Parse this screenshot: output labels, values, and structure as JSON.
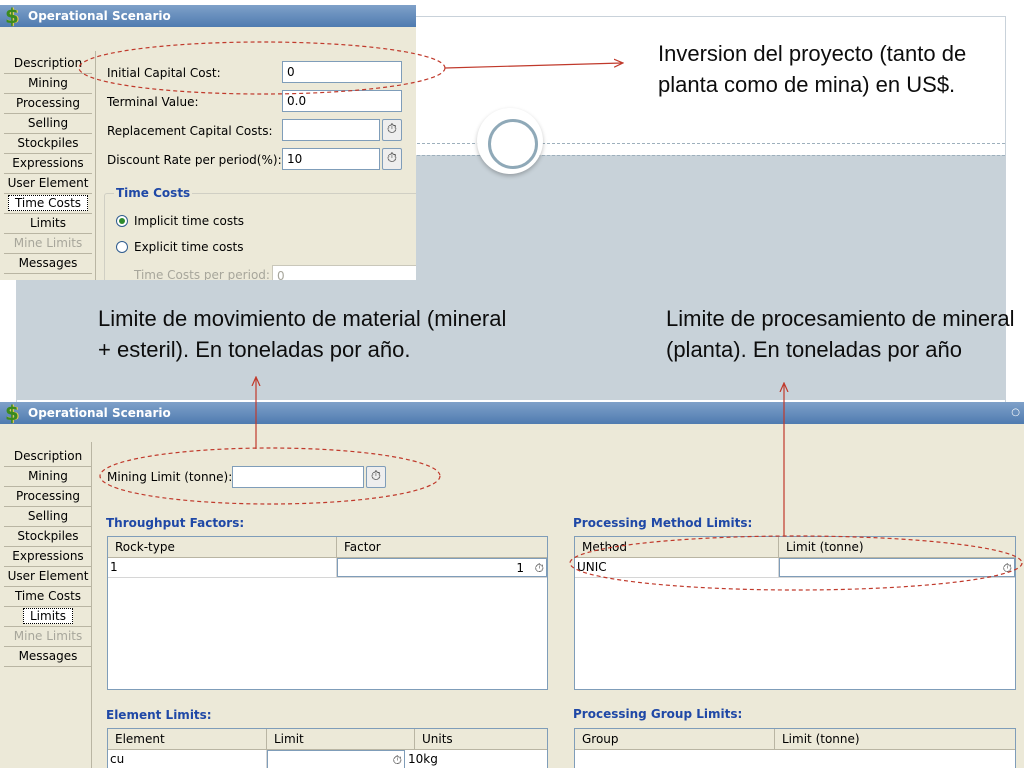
{
  "annotations": {
    "top_note": "Inversion del proyecto (tanto de planta como de mina) en US$.",
    "left_note": "Limite de movimiento de material (mineral + esteril). En toneladas por año.",
    "right_note": "Limite de procesamiento de mineral (planta). En toneladas por año"
  },
  "colors": {
    "callout_ellipse": "#c0392b",
    "title_bar": "#5a84b8",
    "panel_bg": "#ece9d8",
    "group_title": "#1f48a6",
    "slide_band": "#c8d2d9"
  },
  "icons": {
    "app": "dollar-sign-icon",
    "edit": "timer-icon",
    "pin": "pin-icon"
  },
  "nav_items": [
    "Description",
    "Mining",
    "Processing",
    "Selling",
    "Stockpiles",
    "Expressions",
    "User Element",
    "Time Costs",
    "Limits",
    "Mine Limits",
    "Messages"
  ],
  "panel_top": {
    "title": "Operational Scenario",
    "app_icon_glyph": "$",
    "active_nav": "Time Costs",
    "disabled_nav": "Mine Limits",
    "fields": {
      "initial_capital_cost": {
        "label": "Initial Capital Cost:",
        "value": "0"
      },
      "terminal_value": {
        "label": "Terminal Value:",
        "value": "0.0"
      },
      "replacement_capital_costs": {
        "label": "Replacement Capital Costs:",
        "value": ""
      },
      "discount_rate": {
        "label": "Discount Rate per period(%):",
        "value": "10"
      }
    },
    "time_costs": {
      "title": "Time Costs",
      "implicit_label": "Implicit time costs",
      "explicit_label": "Explicit time costs",
      "selected": "implicit",
      "per_period_label": "Time Costs per period:",
      "per_period_value": "0"
    }
  },
  "panel_bottom": {
    "title": "Operational Scenario",
    "app_icon_glyph": "$",
    "pin_glyph": "○",
    "active_nav": "Limits",
    "disabled_nav": "Mine Limits",
    "mining_limit": {
      "label": "Mining Limit (tonne):",
      "value": ""
    },
    "throughput_factors": {
      "title": "Throughput Factors:",
      "columns": [
        "Rock-type",
        "Factor"
      ],
      "rows": [
        {
          "rock_type": "1",
          "factor": "1"
        }
      ]
    },
    "processing_method_limits": {
      "title": "Processing Method Limits:",
      "columns": [
        "Method",
        "Limit (tonne)"
      ],
      "rows": [
        {
          "method": "UNIC",
          "limit": ""
        }
      ]
    },
    "element_limits": {
      "title": "Element Limits:",
      "columns": [
        "Element",
        "Limit",
        "Units"
      ],
      "rows": [
        {
          "element": "cu",
          "limit": "",
          "units": "10kg"
        }
      ]
    },
    "processing_group_limits": {
      "title": "Processing Group Limits:",
      "columns": [
        "Group",
        "Limit (tonne)"
      ],
      "rows": []
    }
  }
}
